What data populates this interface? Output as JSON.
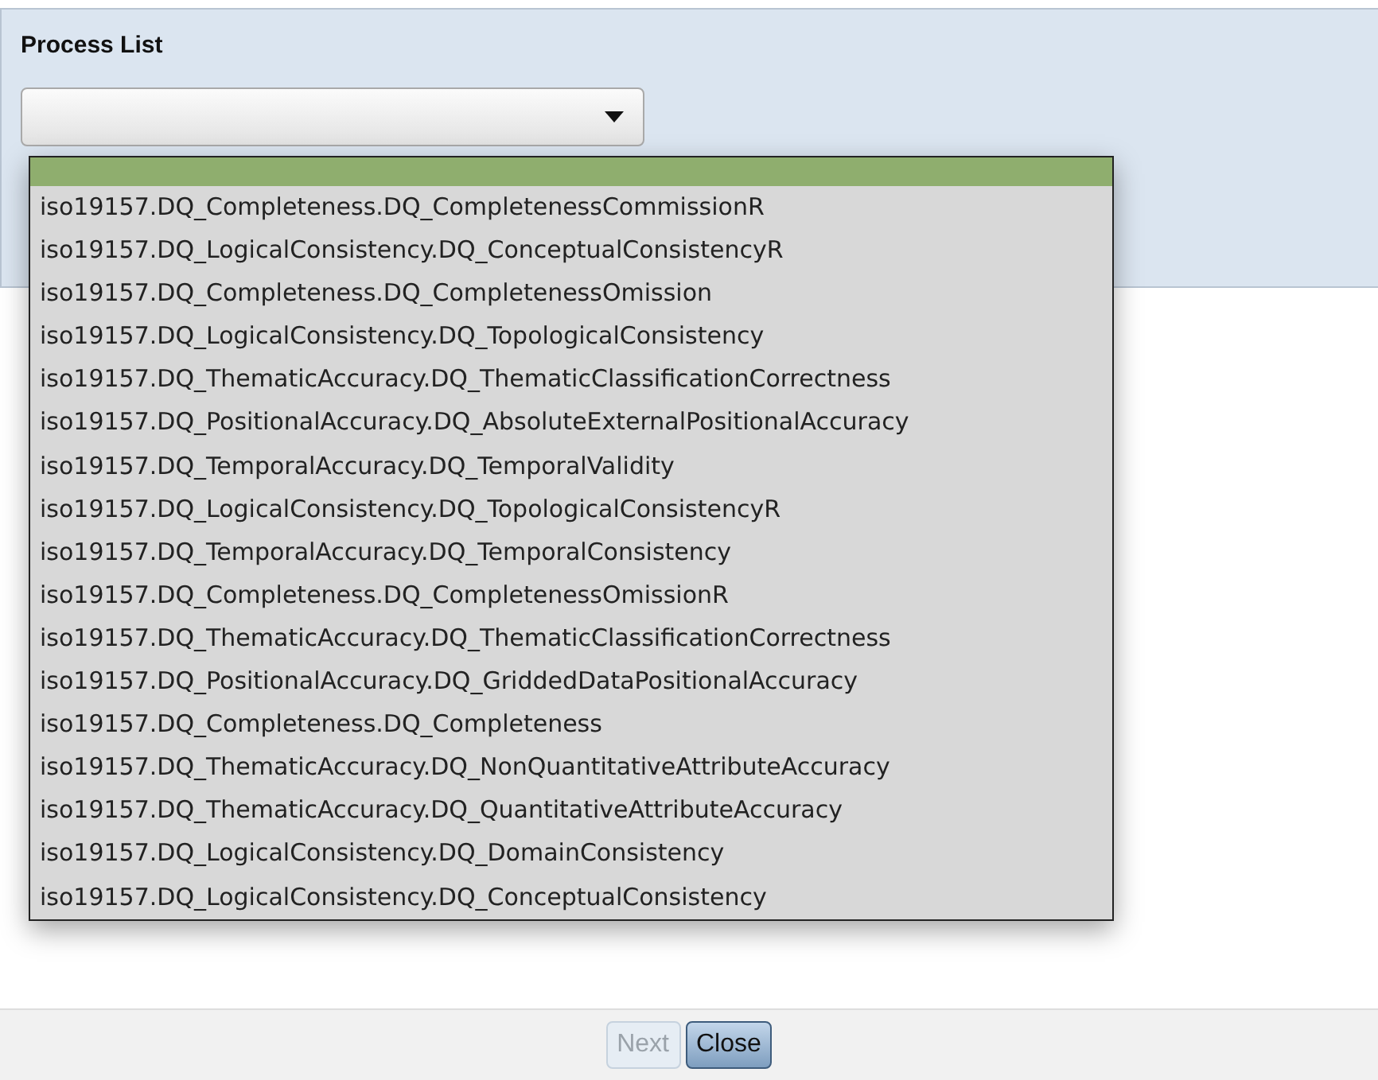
{
  "panel": {
    "title": "Process List"
  },
  "process_select": {
    "expanded": true,
    "options": [
      {
        "selected": true
      },
      {
        "label": "iso19157.DQ_Completeness.DQ_CompletenessCommissionR",
        "selected": false
      },
      {
        "label": "iso19157.DQ_LogicalConsistency.DQ_ConceptualConsistencyR",
        "selected": false
      },
      {
        "label": "iso19157.DQ_Completeness.DQ_CompletenessOmission",
        "selected": false
      },
      {
        "label": "iso19157.DQ_LogicalConsistency.DQ_TopologicalConsistency",
        "selected": false
      },
      {
        "label": "iso19157.DQ_ThematicAccuracy.DQ_ThematicClassificationCorrectness",
        "selected": false
      },
      {
        "label": "iso19157.DQ_PositionalAccuracy.DQ_AbsoluteExternalPositionalAccuracy",
        "selected": false
      },
      {
        "label": "iso19157.DQ_TemporalAccuracy.DQ_TemporalValidity",
        "selected": false
      },
      {
        "label": "iso19157.DQ_LogicalConsistency.DQ_TopologicalConsistencyR",
        "selected": false
      },
      {
        "label": "iso19157.DQ_TemporalAccuracy.DQ_TemporalConsistency",
        "selected": false
      },
      {
        "label": "iso19157.DQ_Completeness.DQ_CompletenessOmissionR",
        "selected": false
      },
      {
        "label": "iso19157.DQ_ThematicAccuracy.DQ_ThematicClassificationCorrectness",
        "selected": false
      },
      {
        "label": "iso19157.DQ_PositionalAccuracy.DQ_GriddedDataPositionalAccuracy",
        "selected": false
      },
      {
        "label": "iso19157.DQ_Completeness.DQ_Completeness",
        "selected": false
      },
      {
        "label": "iso19157.DQ_ThematicAccuracy.DQ_NonQuantitativeAttributeAccuracy",
        "selected": false
      },
      {
        "label": "iso19157.DQ_ThematicAccuracy.DQ_QuantitativeAttributeAccuracy",
        "selected": false
      },
      {
        "label": "iso19157.DQ_LogicalConsistency.DQ_DomainConsistency",
        "selected": false
      },
      {
        "label": "iso19157.DQ_LogicalConsistency.DQ_ConceptualConsistency",
        "selected": false
      }
    ]
  },
  "buttons": [
    {
      "label": "Next",
      "disabled": true
    },
    {
      "label": "Close",
      "disabled": false
    }
  ]
}
